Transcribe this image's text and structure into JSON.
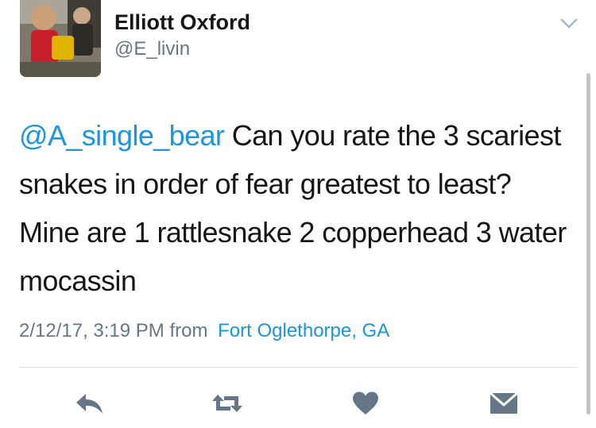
{
  "author": {
    "name": "Elliott Oxford",
    "handle": "@E_livin"
  },
  "tweet": {
    "mention": "@A_single_bear",
    "text": " Can you rate the 3 scariest snakes in order of fear greatest to least? Mine are 1 rattlesnake 2 copperhead 3 water mocassin",
    "timestamp": "2/12/17, 3:19 PM",
    "from_label": "from",
    "location": "Fort Oglethorpe, GA"
  },
  "actions": [
    {
      "name": "reply",
      "icon": "reply-icon"
    },
    {
      "name": "retweet",
      "icon": "retweet-icon"
    },
    {
      "name": "like",
      "icon": "heart-icon"
    },
    {
      "name": "message",
      "icon": "envelope-icon"
    }
  ],
  "colors": {
    "accent": "#1b95e0",
    "text": "#14171a",
    "secondary": "#657786",
    "icon": "#657786"
  }
}
